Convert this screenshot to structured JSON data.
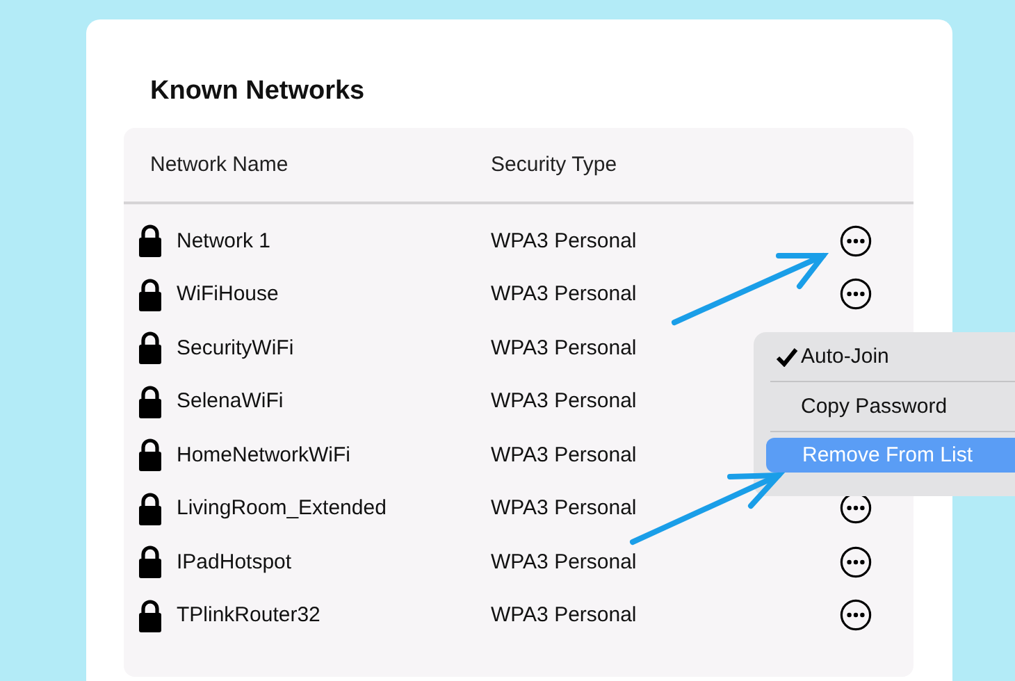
{
  "title": "Known Networks",
  "table": {
    "columns": [
      "Network Name",
      "Security Type"
    ],
    "rows": [
      {
        "name": "Network 1",
        "security": "WPA3 Personal",
        "actions_visible": true
      },
      {
        "name": "WiFiHouse",
        "security": "WPA3 Personal",
        "actions_visible": true
      },
      {
        "name": "SecurityWiFi",
        "security": "WPA3 Personal",
        "actions_visible": false
      },
      {
        "name": "SelenaWiFi",
        "security": "WPA3 Personal",
        "actions_visible": false
      },
      {
        "name": "HomeNetworkWiFi",
        "security": "WPA3 Personal",
        "actions_visible": false
      },
      {
        "name": "LivingRoom_Extended",
        "security": "WPA3 Personal",
        "actions_visible": true
      },
      {
        "name": "IPadHotspot",
        "security": "WPA3 Personal",
        "actions_visible": true
      },
      {
        "name": "TPlinkRouter32",
        "security": "WPA3 Personal",
        "actions_visible": true
      }
    ]
  },
  "context_menu": {
    "items": [
      {
        "label": "Auto-Join",
        "checked": true,
        "selected": false
      },
      {
        "label": "Copy Password",
        "checked": false,
        "selected": false
      },
      {
        "label": "Remove From List",
        "checked": false,
        "selected": true
      }
    ]
  }
}
